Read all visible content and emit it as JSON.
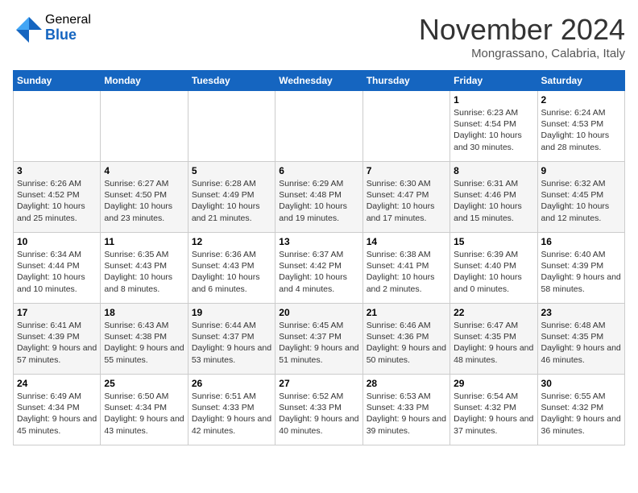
{
  "header": {
    "logo_general": "General",
    "logo_blue": "Blue",
    "month_title": "November 2024",
    "location": "Mongrassano, Calabria, Italy"
  },
  "weekdays": [
    "Sunday",
    "Monday",
    "Tuesday",
    "Wednesday",
    "Thursday",
    "Friday",
    "Saturday"
  ],
  "weeks": [
    [
      {
        "day": "",
        "info": ""
      },
      {
        "day": "",
        "info": ""
      },
      {
        "day": "",
        "info": ""
      },
      {
        "day": "",
        "info": ""
      },
      {
        "day": "",
        "info": ""
      },
      {
        "day": "1",
        "info": "Sunrise: 6:23 AM\nSunset: 4:54 PM\nDaylight: 10 hours and 30 minutes."
      },
      {
        "day": "2",
        "info": "Sunrise: 6:24 AM\nSunset: 4:53 PM\nDaylight: 10 hours and 28 minutes."
      }
    ],
    [
      {
        "day": "3",
        "info": "Sunrise: 6:26 AM\nSunset: 4:52 PM\nDaylight: 10 hours and 25 minutes."
      },
      {
        "day": "4",
        "info": "Sunrise: 6:27 AM\nSunset: 4:50 PM\nDaylight: 10 hours and 23 minutes."
      },
      {
        "day": "5",
        "info": "Sunrise: 6:28 AM\nSunset: 4:49 PM\nDaylight: 10 hours and 21 minutes."
      },
      {
        "day": "6",
        "info": "Sunrise: 6:29 AM\nSunset: 4:48 PM\nDaylight: 10 hours and 19 minutes."
      },
      {
        "day": "7",
        "info": "Sunrise: 6:30 AM\nSunset: 4:47 PM\nDaylight: 10 hours and 17 minutes."
      },
      {
        "day": "8",
        "info": "Sunrise: 6:31 AM\nSunset: 4:46 PM\nDaylight: 10 hours and 15 minutes."
      },
      {
        "day": "9",
        "info": "Sunrise: 6:32 AM\nSunset: 4:45 PM\nDaylight: 10 hours and 12 minutes."
      }
    ],
    [
      {
        "day": "10",
        "info": "Sunrise: 6:34 AM\nSunset: 4:44 PM\nDaylight: 10 hours and 10 minutes."
      },
      {
        "day": "11",
        "info": "Sunrise: 6:35 AM\nSunset: 4:43 PM\nDaylight: 10 hours and 8 minutes."
      },
      {
        "day": "12",
        "info": "Sunrise: 6:36 AM\nSunset: 4:43 PM\nDaylight: 10 hours and 6 minutes."
      },
      {
        "day": "13",
        "info": "Sunrise: 6:37 AM\nSunset: 4:42 PM\nDaylight: 10 hours and 4 minutes."
      },
      {
        "day": "14",
        "info": "Sunrise: 6:38 AM\nSunset: 4:41 PM\nDaylight: 10 hours and 2 minutes."
      },
      {
        "day": "15",
        "info": "Sunrise: 6:39 AM\nSunset: 4:40 PM\nDaylight: 10 hours and 0 minutes."
      },
      {
        "day": "16",
        "info": "Sunrise: 6:40 AM\nSunset: 4:39 PM\nDaylight: 9 hours and 58 minutes."
      }
    ],
    [
      {
        "day": "17",
        "info": "Sunrise: 6:41 AM\nSunset: 4:39 PM\nDaylight: 9 hours and 57 minutes."
      },
      {
        "day": "18",
        "info": "Sunrise: 6:43 AM\nSunset: 4:38 PM\nDaylight: 9 hours and 55 minutes."
      },
      {
        "day": "19",
        "info": "Sunrise: 6:44 AM\nSunset: 4:37 PM\nDaylight: 9 hours and 53 minutes."
      },
      {
        "day": "20",
        "info": "Sunrise: 6:45 AM\nSunset: 4:37 PM\nDaylight: 9 hours and 51 minutes."
      },
      {
        "day": "21",
        "info": "Sunrise: 6:46 AM\nSunset: 4:36 PM\nDaylight: 9 hours and 50 minutes."
      },
      {
        "day": "22",
        "info": "Sunrise: 6:47 AM\nSunset: 4:35 PM\nDaylight: 9 hours and 48 minutes."
      },
      {
        "day": "23",
        "info": "Sunrise: 6:48 AM\nSunset: 4:35 PM\nDaylight: 9 hours and 46 minutes."
      }
    ],
    [
      {
        "day": "24",
        "info": "Sunrise: 6:49 AM\nSunset: 4:34 PM\nDaylight: 9 hours and 45 minutes."
      },
      {
        "day": "25",
        "info": "Sunrise: 6:50 AM\nSunset: 4:34 PM\nDaylight: 9 hours and 43 minutes."
      },
      {
        "day": "26",
        "info": "Sunrise: 6:51 AM\nSunset: 4:33 PM\nDaylight: 9 hours and 42 minutes."
      },
      {
        "day": "27",
        "info": "Sunrise: 6:52 AM\nSunset: 4:33 PM\nDaylight: 9 hours and 40 minutes."
      },
      {
        "day": "28",
        "info": "Sunrise: 6:53 AM\nSunset: 4:33 PM\nDaylight: 9 hours and 39 minutes."
      },
      {
        "day": "29",
        "info": "Sunrise: 6:54 AM\nSunset: 4:32 PM\nDaylight: 9 hours and 37 minutes."
      },
      {
        "day": "30",
        "info": "Sunrise: 6:55 AM\nSunset: 4:32 PM\nDaylight: 9 hours and 36 minutes."
      }
    ]
  ]
}
